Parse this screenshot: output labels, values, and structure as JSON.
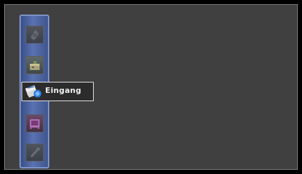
{
  "menu": {
    "items": [
      {
        "icon": "camera-icon",
        "label": "",
        "state": "disabled"
      },
      {
        "icon": "toolbox-icon",
        "label": "",
        "state": "normal"
      },
      {
        "icon": "inbox-icon",
        "label": "Eingang",
        "state": "selected"
      },
      {
        "icon": "media-player-icon",
        "label": "",
        "state": "normal"
      },
      {
        "icon": "wrench-icon",
        "label": "",
        "state": "disabled"
      }
    ]
  },
  "colors": {
    "panel_bg": "#404040",
    "sidebar_blue": "#5a72b1",
    "highlight_border": "#e6e6e6"
  }
}
